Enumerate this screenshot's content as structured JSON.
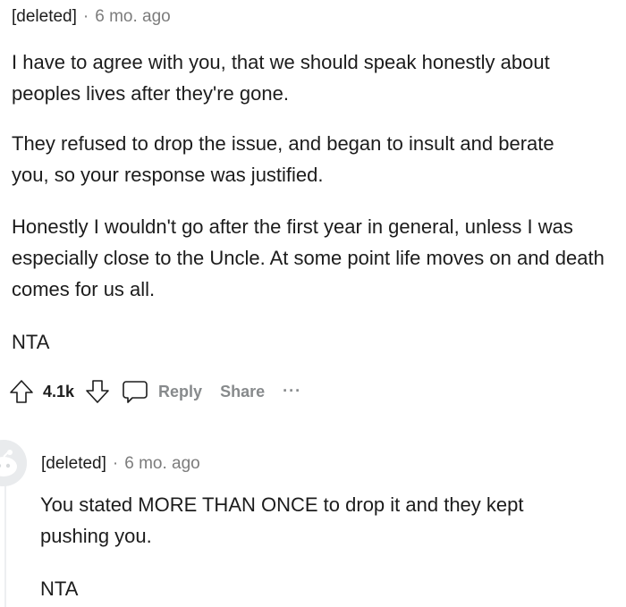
{
  "comment": {
    "author": "[deleted]",
    "separator": "·",
    "time": "6 mo. ago",
    "paragraphs": [
      "I have to agree with you, that we should speak honestly about peoples lives after they're gone.",
      "They refused to drop the issue, and began to insult and berate you, so your response was justified.",
      "Honestly I wouldn't go after the first year in general, unless I was especially close to the Uncle. At some point life moves on and death comes for us all.",
      "NTA"
    ],
    "votes": "4.1k",
    "reply_label": "Reply",
    "share_label": "Share",
    "more_label": "..."
  },
  "reply": {
    "author": "[deleted]",
    "separator": "·",
    "time": "6 mo. ago",
    "paragraphs": [
      "You stated MORE THAN ONCE to drop it and they kept pushing you.",
      "NTA"
    ]
  },
  "icons": {
    "upvote": "upvote-arrow-icon",
    "downvote": "downvote-arrow-icon",
    "reply": "speech-bubble-icon",
    "avatar": "reddit-default-avatar-icon"
  },
  "colors": {
    "text": "#1c1c1c",
    "muted": "#7c7c7c",
    "action_gray": "#878a8c"
  }
}
